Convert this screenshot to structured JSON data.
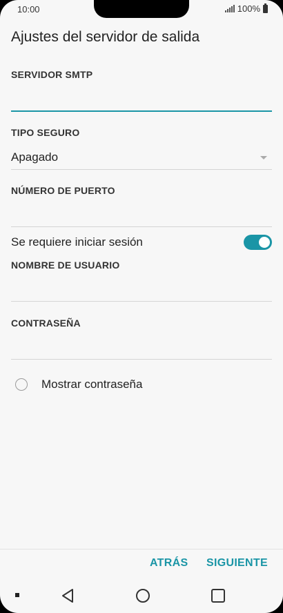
{
  "status_bar": {
    "time": "10:00",
    "battery_text": "100%"
  },
  "page": {
    "title": "Ajustes del servidor de salida"
  },
  "form": {
    "smtp_server": {
      "label": "SERVIDOR SMTP",
      "value": ""
    },
    "security_type": {
      "label": "TIPO SEGURO",
      "value": "Apagado"
    },
    "port_number": {
      "label": "NÚMERO DE PUERTO",
      "value": ""
    },
    "login_required": {
      "label": "Se requiere iniciar sesión",
      "enabled": true
    },
    "username": {
      "label": "NOMBRE DE USUARIO",
      "value": ""
    },
    "password": {
      "label": "CONTRASEÑA",
      "value": ""
    },
    "show_password": {
      "label": "Mostrar contraseña",
      "checked": false
    }
  },
  "actions": {
    "back_label": "ATRÁS",
    "next_label": "SIGUIENTE"
  },
  "colors": {
    "accent": "#1a95a6",
    "background": "#f7f7f7"
  }
}
